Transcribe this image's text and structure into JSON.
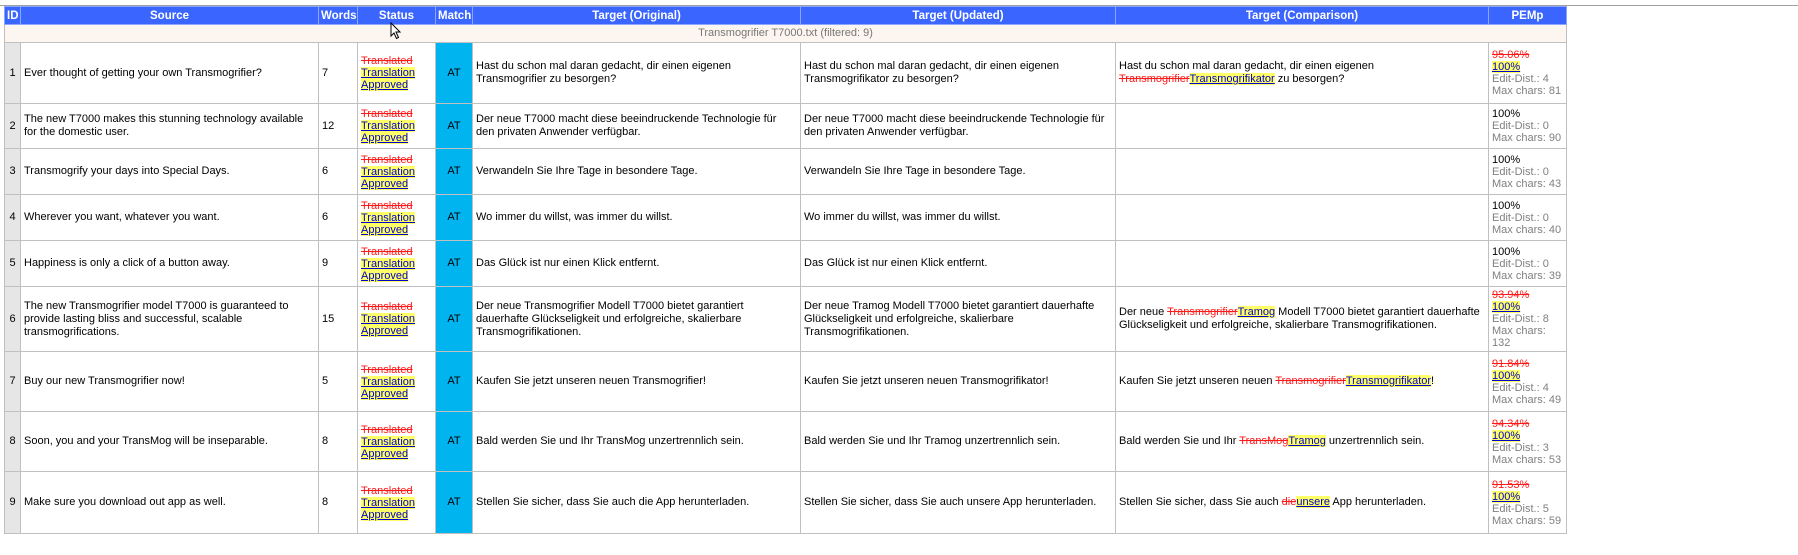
{
  "table": {
    "headers": {
      "id": "ID",
      "source": "Source",
      "words": "Words",
      "status": "Status",
      "match": "Match",
      "target_original": "Target (Original)",
      "target_updated": "Target (Updated)",
      "target_comparison": "Target (Comparison)",
      "pemp": "PEMp"
    },
    "file_label": "Transmogrifier T7000.txt  (filtered: 9)",
    "status_old": "Translated",
    "status_new_line1": "Translation",
    "status_new_line2": "Approved",
    "edit_dist_label": "Edit-Dist.:",
    "max_chars_label": "Max chars:",
    "rows": [
      {
        "id": "1",
        "source": "Ever thought of getting your own Transmogrifier?",
        "words": "7",
        "match": "AT",
        "target_original": "Hast du schon mal daran gedacht, dir einen eigenen Transmogrifier zu besorgen?",
        "target_updated": "Hast du schon mal daran gedacht, dir einen eigenen Transmogrifikator zu besorgen?",
        "comparison": {
          "prefix": "Hast du schon mal daran gedacht, dir einen eigenen ",
          "deleted": "Transmogrifier",
          "inserted": "Transmogrifikator",
          "suffix": " zu besorgen?"
        },
        "pemp": {
          "old": "95.06%",
          "new": "100%",
          "edit_dist": "4",
          "max_chars": "81"
        }
      },
      {
        "id": "2",
        "source": "The new T7000 makes this stunning technology available for the domestic user.",
        "words": "12",
        "match": "AT",
        "target_original": "Der neue T7000 macht diese beeindruckende Technologie für den privaten Anwender verfügbar.",
        "target_updated": "Der neue T7000 macht diese beeindruckende Technologie für den privaten Anwender verfügbar.",
        "comparison": null,
        "pemp": {
          "old": null,
          "new": "100%",
          "edit_dist": "0",
          "max_chars": "90"
        }
      },
      {
        "id": "3",
        "source": "Transmogrify your days into Special Days.",
        "words": "6",
        "match": "AT",
        "target_original": "Verwandeln Sie Ihre Tage in besondere Tage.",
        "target_updated": "Verwandeln Sie Ihre Tage in besondere Tage.",
        "comparison": null,
        "pemp": {
          "old": null,
          "new": "100%",
          "edit_dist": "0",
          "max_chars": "43"
        }
      },
      {
        "id": "4",
        "source": "Wherever you want, whatever you want.",
        "words": "6",
        "match": "AT",
        "target_original": "Wo immer du willst, was immer du willst.",
        "target_updated": "Wo immer du willst, was immer du willst.",
        "comparison": null,
        "pemp": {
          "old": null,
          "new": "100%",
          "edit_dist": "0",
          "max_chars": "40"
        }
      },
      {
        "id": "5",
        "source": "Happiness is only a click of a button away.",
        "words": "9",
        "match": "AT",
        "target_original": "Das Glück ist nur einen Klick entfernt.",
        "target_updated": "Das Glück ist nur einen Klick entfernt.",
        "comparison": null,
        "pemp": {
          "old": null,
          "new": "100%",
          "edit_dist": "0",
          "max_chars": "39"
        }
      },
      {
        "id": "6",
        "source": "The new Transmogrifier model T7000 is guaranteed to provide lasting bliss and successful, scalable transmogrifications.",
        "words": "15",
        "match": "AT",
        "target_original": "Der neue Transmogrifier Modell T7000 bietet garantiert dauerhafte Glückseligkeit und erfolgreiche, skalierbare Transmogrifikationen.",
        "target_updated": "Der neue Tramog Modell T7000 bietet garantiert dauerhafte Glückseligkeit und erfolgreiche, skalierbare Transmogrifikationen.",
        "comparison": {
          "prefix": "Der neue ",
          "deleted": "Transmogrifier",
          "inserted": "Tramog",
          "suffix": " Modell T7000 bietet garantiert dauerhafte Glückseligkeit und erfolgreiche, skalierbare Transmogrifikationen."
        },
        "pemp": {
          "old": "93.94%",
          "new": "100%",
          "edit_dist": "8",
          "max_chars": "132"
        }
      },
      {
        "id": "7",
        "source": "Buy our new Transmogrifier now!",
        "words": "5",
        "match": "AT",
        "target_original": "Kaufen Sie jetzt unseren neuen Transmogrifier!",
        "target_updated": "Kaufen Sie jetzt unseren neuen Transmogrifikator!",
        "comparison": {
          "prefix": "Kaufen Sie jetzt unseren neuen ",
          "deleted": "Transmogrifier",
          "inserted": "Transmogrifikator",
          "suffix": "!"
        },
        "pemp": {
          "old": "91.84%",
          "new": "100%",
          "edit_dist": "4",
          "max_chars": "49"
        }
      },
      {
        "id": "8",
        "source": "Soon, you and your TransMog will be inseparable.",
        "words": "8",
        "match": "AT",
        "target_original": "Bald werden Sie und Ihr TransMog unzertrennlich sein.",
        "target_updated": "Bald werden Sie und Ihr Tramog unzertrennlich sein.",
        "comparison": {
          "prefix": "Bald werden Sie und Ihr ",
          "deleted": "TransMog",
          "inserted": "Tramog",
          "suffix": " unzertrennlich sein."
        },
        "pemp": {
          "old": "94.34%",
          "new": "100%",
          "edit_dist": "3",
          "max_chars": "53"
        }
      },
      {
        "id": "9",
        "source": "Make sure you download out app as well.",
        "words": "8",
        "match": "AT",
        "target_original": "Stellen Sie sicher, dass Sie auch die App herunterladen.",
        "target_updated": "Stellen Sie sicher, dass Sie auch unsere App herunterladen.",
        "comparison": {
          "prefix": "Stellen Sie sicher, dass Sie auch ",
          "deleted": "die",
          "inserted": "unsere",
          "suffix": " App herunterladen."
        },
        "pemp": {
          "old": "91.53%",
          "new": "100%",
          "edit_dist": "5",
          "max_chars": "59"
        }
      }
    ]
  }
}
